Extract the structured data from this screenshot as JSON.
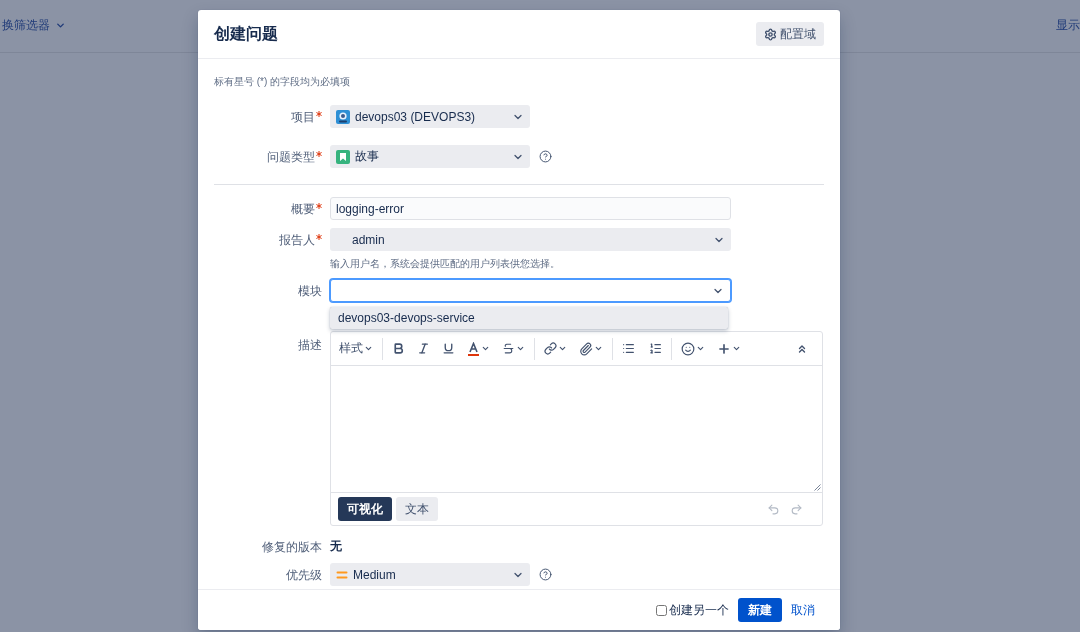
{
  "background": {
    "filter_menu": "换筛选器",
    "right_link": "显示"
  },
  "dialog": {
    "title": "创建问题",
    "configure_button": "配置域",
    "required_note": "标有星号 (*) 的字段均为必填项",
    "project": {
      "label": "项目",
      "required": true,
      "value": "devops03 (DEVOPS3)"
    },
    "issue_type": {
      "label": "问题类型",
      "required": true,
      "value": "故事",
      "help": true
    },
    "summary": {
      "label": "概要",
      "required": true,
      "value": "logging-error"
    },
    "reporter": {
      "label": "报告人",
      "required": true,
      "value": "admin",
      "hint": "输入用户名，系统会提供匹配的用户列表供您选择。"
    },
    "component": {
      "label": "模块",
      "required": false,
      "focused": true,
      "suggestions": [
        {
          "label": "devops03-devops-service",
          "selected": true
        }
      ]
    },
    "description": {
      "label": "描述",
      "required": false,
      "toolbar": {
        "style_menu": "样式"
      },
      "modes": [
        {
          "label": "可视化",
          "selected": true
        },
        {
          "label": "文本",
          "selected": false
        }
      ],
      "undo": {
        "disabled": true
      },
      "redo": {
        "disabled": true
      }
    },
    "fix_versions": {
      "label": "修复的版本",
      "required": false,
      "value": "无"
    },
    "priority": {
      "label": "优先级",
      "required": false,
      "value": "Medium",
      "help": true
    },
    "footer": {
      "create_another": {
        "label": "创建另一个",
        "checked": false
      },
      "submit": "新建",
      "cancel": "取消"
    }
  }
}
